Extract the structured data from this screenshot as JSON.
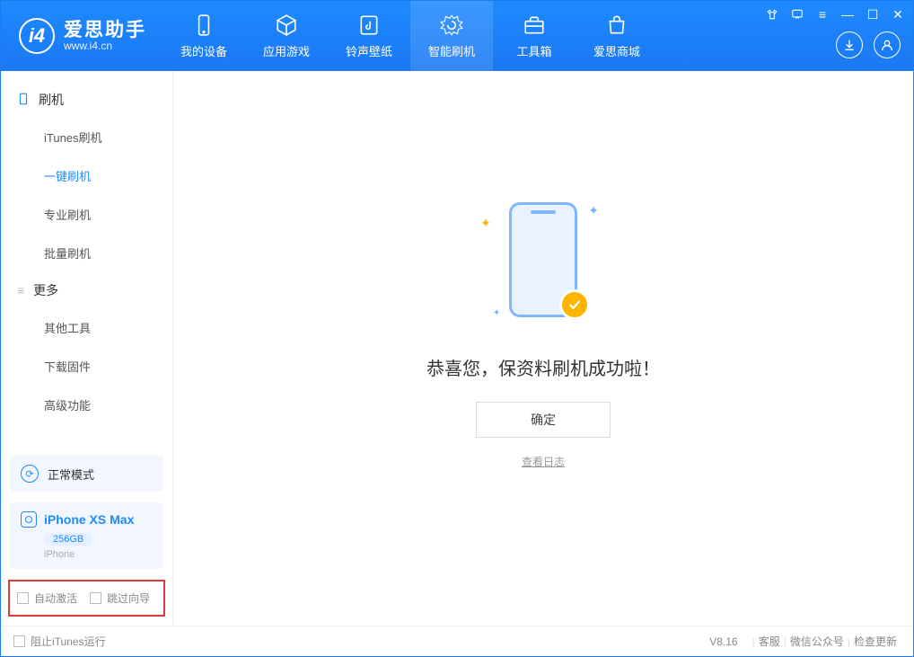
{
  "app": {
    "name_cn": "爱思助手",
    "name_en": "www.i4.cn"
  },
  "nav": {
    "items": [
      {
        "label": "我的设备",
        "icon": "device-icon"
      },
      {
        "label": "应用游戏",
        "icon": "cube-icon"
      },
      {
        "label": "铃声壁纸",
        "icon": "music-icon"
      },
      {
        "label": "智能刷机",
        "icon": "refresh-icon",
        "active": true
      },
      {
        "label": "工具箱",
        "icon": "toolbox-icon"
      },
      {
        "label": "爱思商城",
        "icon": "shop-icon"
      }
    ]
  },
  "sidebar": {
    "section1": {
      "title": "刷机",
      "items": [
        "iTunes刷机",
        "一键刷机",
        "专业刷机",
        "批量刷机"
      ],
      "active_index": 1
    },
    "section2": {
      "title": "更多",
      "items": [
        "其他工具",
        "下载固件",
        "高级功能"
      ]
    },
    "mode_label": "正常模式",
    "device": {
      "name": "iPhone XS Max",
      "capacity": "256GB",
      "type": "iPhone"
    },
    "options": {
      "auto_activate": "自动激活",
      "skip_guide": "跳过向导"
    }
  },
  "main": {
    "success_message": "恭喜您，保资料刷机成功啦！",
    "ok_button": "确定",
    "view_log": "查看日志"
  },
  "statusbar": {
    "block_itunes": "阻止iTunes运行",
    "version": "V8.16",
    "links": [
      "客服",
      "微信公众号",
      "检查更新"
    ]
  }
}
